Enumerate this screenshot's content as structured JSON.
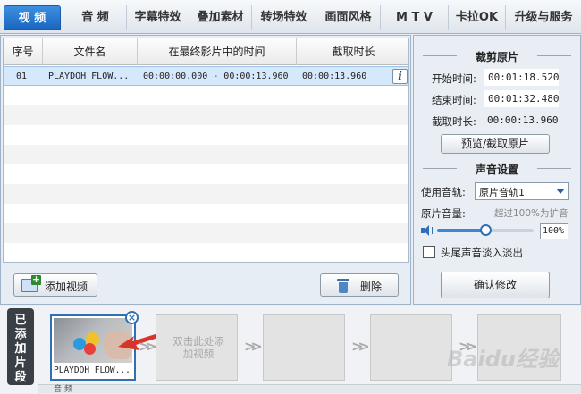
{
  "tabs": [
    {
      "label": "视 频",
      "active": true
    },
    {
      "label": "音 频"
    },
    {
      "label": "字幕特效"
    },
    {
      "label": "叠加素材"
    },
    {
      "label": "转场特效"
    },
    {
      "label": "画面风格"
    },
    {
      "label": "M T V"
    },
    {
      "label": "卡拉OK"
    },
    {
      "label": "升级与服务"
    }
  ],
  "table": {
    "columns": [
      "序号",
      "文件名",
      "在最终影片中的时间",
      "截取时长"
    ],
    "rows": [
      {
        "index": "01",
        "filename": "PLAYDOH FLOW...",
        "time": "00:00:00.000 - 00:00:13.960",
        "duration": "00:00:13.960"
      }
    ]
  },
  "buttons": {
    "add_video": "添加视频",
    "delete": "删除",
    "preview_clip": "预览/截取原片",
    "confirm": "确认修改"
  },
  "clip": {
    "title": "裁剪原片",
    "start_label": "开始时间:",
    "start_value": "00:01:18.520",
    "end_label": "结束时间:",
    "end_value": "00:01:32.480",
    "duration_label": "截取时长:",
    "duration_value": "00:00:13.960"
  },
  "audio": {
    "title": "声音设置",
    "track_label": "使用音轨:",
    "track_value": "原片音轨1",
    "volume_label": "原片音量:",
    "volume_hint": "超过100%为扩音",
    "volume_value": "100%",
    "volume_level": 0.5,
    "fade_label": "头尾声音淡入淡出",
    "fade_checked": false
  },
  "timeline": {
    "side_label": "已添加片段",
    "clip_name": "PLAYDOH FLOW...",
    "empty_hint": "双击此处添加视频",
    "audio_label": "音 频"
  },
  "watermark": "Baidu经验",
  "colors": {
    "accent": "#1a66c1",
    "selection": "#d6e8fb",
    "side_label_bg": "#3a3f46"
  }
}
